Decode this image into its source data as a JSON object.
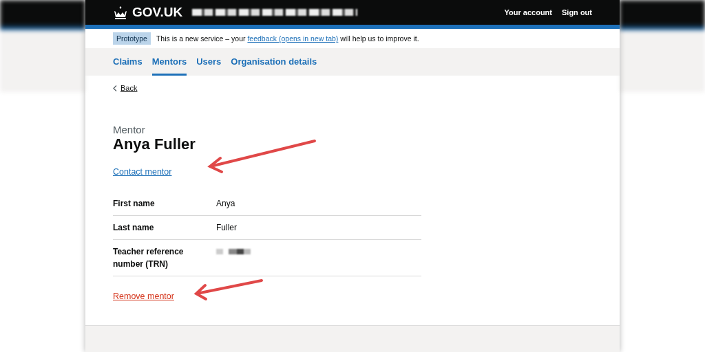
{
  "header": {
    "logo": "GOV.UK",
    "links": [
      {
        "label": "Your account"
      },
      {
        "label": "Sign out"
      }
    ]
  },
  "phase_banner": {
    "tag": "Prototype",
    "text_before": "This is a new service – your ",
    "link": "feedback (opens in new tab)",
    "text_after": " will help us to improve it."
  },
  "nav": [
    {
      "label": "Claims",
      "selected": false
    },
    {
      "label": "Mentors",
      "selected": true
    },
    {
      "label": "Users",
      "selected": false
    },
    {
      "label": "Organisation details",
      "selected": false
    }
  ],
  "back_link": "Back",
  "caption": "Mentor",
  "heading": "Anya Fuller",
  "contact_link": "Contact mentor",
  "summary": [
    {
      "key": "First name",
      "kind": "text",
      "value": "Anya"
    },
    {
      "key": "Last name",
      "kind": "text",
      "value": "Fuller"
    },
    {
      "key": "Teacher reference number (TRN)",
      "kind": "redacted"
    }
  ],
  "remove_link": "Remove mentor"
}
